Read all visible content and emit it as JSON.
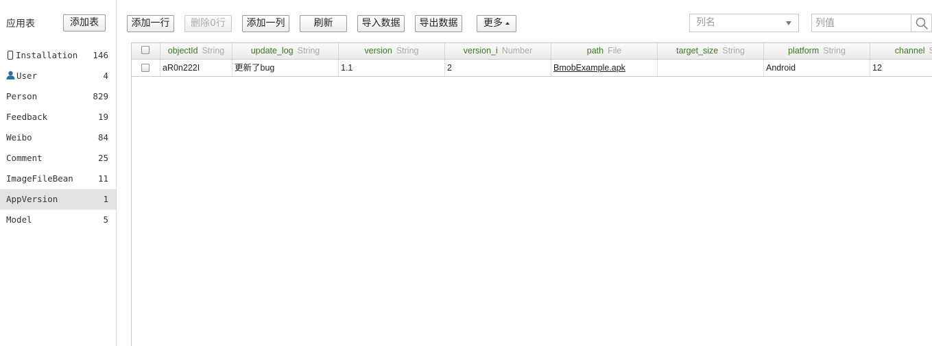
{
  "sidebar": {
    "title": "应用表",
    "add_table_label": "添加表",
    "items": [
      {
        "name": "Installation",
        "count": "146",
        "icon": "phone-icon"
      },
      {
        "name": "User",
        "count": "4",
        "icon": "user-icon"
      },
      {
        "name": "Person",
        "count": "829"
      },
      {
        "name": "Feedback",
        "count": "19"
      },
      {
        "name": "Weibo",
        "count": "84"
      },
      {
        "name": "Comment",
        "count": "25"
      },
      {
        "name": "ImageFileBean",
        "count": "11"
      },
      {
        "name": "AppVersion",
        "count": "1",
        "selected": true
      },
      {
        "name": "Model",
        "count": "5"
      }
    ]
  },
  "toolbar": {
    "add_row": "添加一行",
    "delete_rows": "删除0行",
    "add_column": "添加一列",
    "refresh": "刷新",
    "import": "导入数据",
    "export": "导出数据",
    "more": "更多"
  },
  "filter": {
    "column_placeholder": "列名",
    "value_placeholder": "列值"
  },
  "grid": {
    "columns": [
      {
        "name": "objectId",
        "type": "String"
      },
      {
        "name": "update_log",
        "type": "String"
      },
      {
        "name": "version",
        "type": "String"
      },
      {
        "name": "version_i",
        "type": "Number"
      },
      {
        "name": "path",
        "type": "File"
      },
      {
        "name": "target_size",
        "type": "String"
      },
      {
        "name": "platform",
        "type": "String"
      },
      {
        "name": "channel",
        "type": "String"
      }
    ],
    "rows": [
      {
        "objectId": "aR0n222I",
        "update_log": "更新了bug",
        "version": "1.1",
        "version_i": "2",
        "path": "BmobExample.apk",
        "target_size": "",
        "platform": "Android",
        "channel": "12"
      }
    ]
  },
  "colors": {
    "column_name": "#3a7a1f",
    "column_type": "#aaaaaa",
    "selected_bg": "#e3e3e3"
  }
}
